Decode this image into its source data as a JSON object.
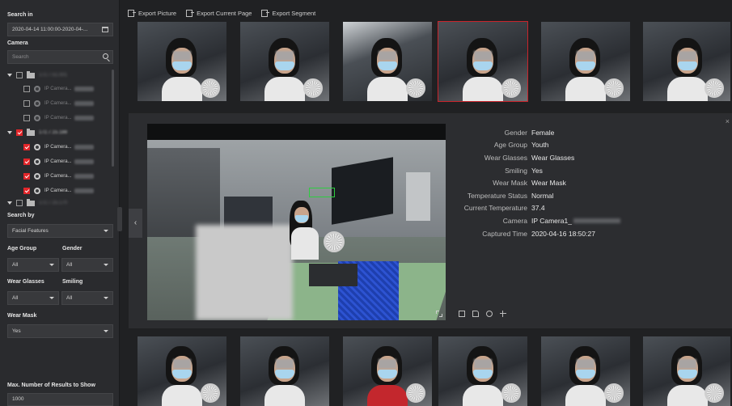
{
  "left_panel": {
    "search_in_label": "Search in",
    "time_range": "2020-04-14 11:00:00-2020-04-...",
    "camera_label": "Camera",
    "camera_search_placeholder": "Search",
    "tree": {
      "group1_label": "172.7.51.001",
      "group1_cameras": [
        "IP Camera...",
        "IP Camera...",
        "IP Camera..."
      ],
      "group2_label": "172.7.15.188",
      "group2_cameras": [
        "IP Camera...",
        "IP Camera...",
        "IP Camera...",
        "IP Camera..."
      ],
      "group3_label": "172.7.15.170"
    },
    "search_by_label": "Search by",
    "search_by_value": "Facial Features",
    "age_group_label": "Age Group",
    "age_group_value": "All",
    "gender_label": "Gender",
    "gender_value": "All",
    "wear_glasses_label": "Wear Glasses",
    "wear_glasses_value": "All",
    "smiling_label": "Smiling",
    "smiling_value": "All",
    "wear_mask_label": "Wear Mask",
    "wear_mask_value": "Yes",
    "max_results_label": "Max. Number of Results to Show",
    "max_results_value": "1000"
  },
  "toolbar": {
    "export_picture": "Export Picture",
    "export_current_page": "Export Current Page",
    "export_segment": "Export Segment"
  },
  "detail": {
    "close": "×",
    "prev": "‹",
    "attributes": [
      {
        "key": "Gender",
        "value": "Female"
      },
      {
        "key": "Age Group",
        "value": "Youth"
      },
      {
        "key": "Wear Glasses",
        "value": "Wear Glasses"
      },
      {
        "key": "Smiling",
        "value": "Yes"
      },
      {
        "key": "Wear Mask",
        "value": "Wear Mask"
      },
      {
        "key": "Temperature Status",
        "value": "Normal"
      },
      {
        "key": "Current Temperature",
        "value": "37.4"
      },
      {
        "key": "Camera",
        "value": "IP Camera1_"
      },
      {
        "key": "Captured Time",
        "value": "2020-04-16 18:50:27"
      }
    ]
  },
  "colors": {
    "accent_red": "#e2262a",
    "panel_bg": "#2a2b2e",
    "page_bg": "#202123"
  }
}
